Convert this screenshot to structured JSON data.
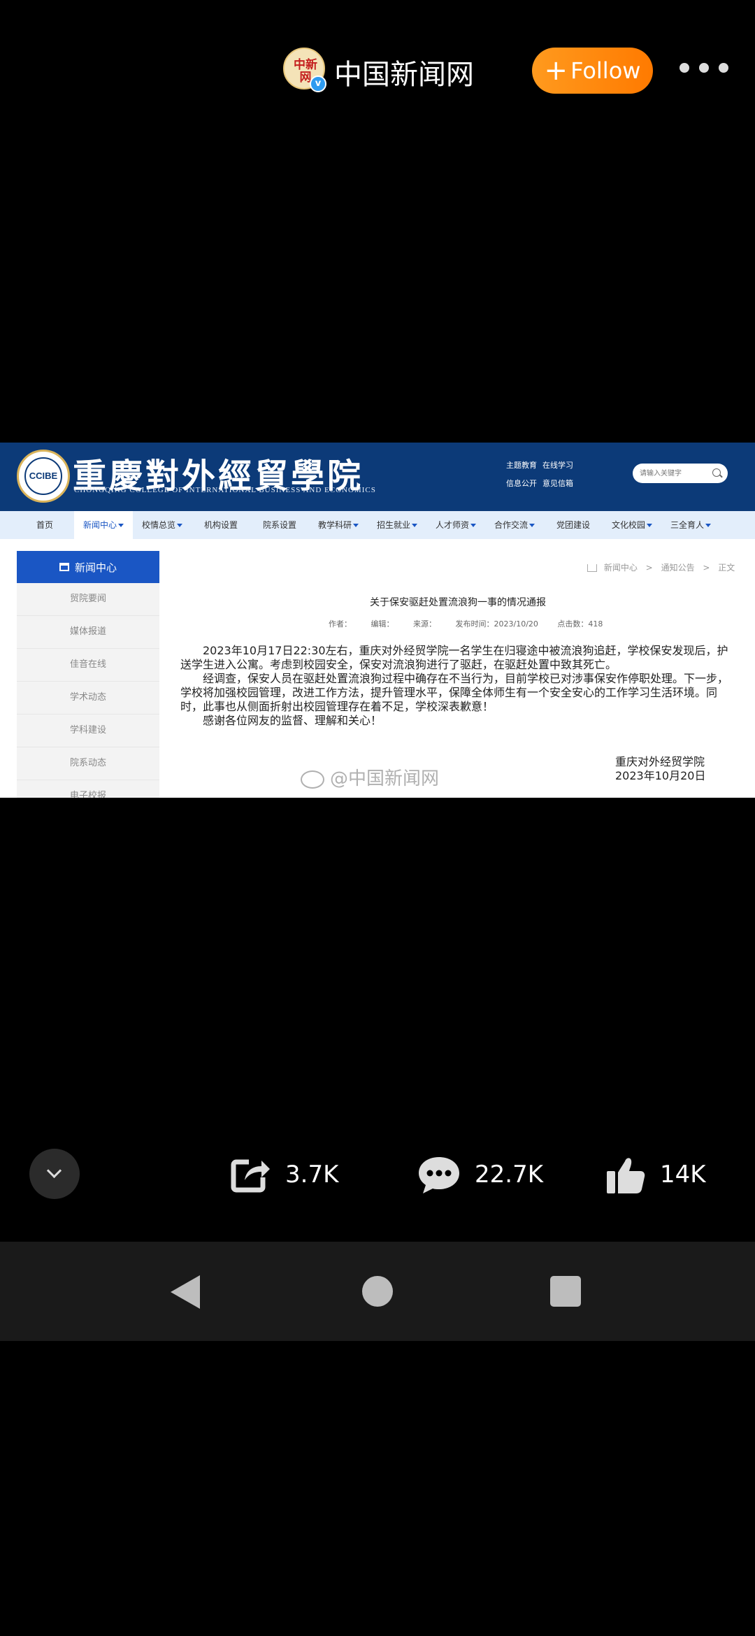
{
  "account": {
    "avatar_text": "中新网",
    "verified_mark": "v",
    "name": "中国新闻网",
    "follow_label": "Follow",
    "follow_plus": "+"
  },
  "webpage": {
    "school_name_cn": "重慶對外經貿學院",
    "school_name_en": "CHONGQING COLLEGE OF INTERNATIONAL BUSINESS AND ECONOMICS",
    "logo_text": "CCIBE",
    "quicklinks": [
      "主题教育",
      "在线学习",
      "信息公开",
      "意见信箱"
    ],
    "search_placeholder": "请输入关键字",
    "nav": [
      {
        "label": "首页",
        "caret": false,
        "active": false
      },
      {
        "label": "新闻中心",
        "caret": true,
        "active": true
      },
      {
        "label": "校情总览",
        "caret": true,
        "active": false
      },
      {
        "label": "机构设置",
        "caret": false,
        "active": false
      },
      {
        "label": "院系设置",
        "caret": false,
        "active": false
      },
      {
        "label": "教学科研",
        "caret": true,
        "active": false
      },
      {
        "label": "招生就业",
        "caret": true,
        "active": false
      },
      {
        "label": "人才师资",
        "caret": true,
        "active": false
      },
      {
        "label": "合作交流",
        "caret": true,
        "active": false
      },
      {
        "label": "党团建设",
        "caret": false,
        "active": false
      },
      {
        "label": "文化校园",
        "caret": true,
        "active": false
      },
      {
        "label": "三全育人",
        "caret": true,
        "active": false
      }
    ],
    "sidebar_title": "新闻中心",
    "sidebar_items": [
      "贸院要闻",
      "媒体报道",
      "佳音在线",
      "学术动态",
      "学科建设",
      "院系动态",
      "电子校报"
    ],
    "breadcrumb": [
      "新闻中心",
      "通知公告",
      "正文"
    ],
    "breadcrumb_sep": ">",
    "article_title": "关于保安驱赶处置流浪狗一事的情况通报",
    "meta": {
      "author": "作者：",
      "editor": "编辑：",
      "source": "来源：",
      "published": "发布时间：2023/10/20",
      "clicks": "点击数：418"
    },
    "paragraphs": [
      "2023年10月17日22:30左右，重庆对外经贸学院一名学生在归寝途中被流浪狗追赶，学校保安发现后，护送学生进入公寓。考虑到校园安全，保安对流浪狗进行了驱赶，在驱赶处置中致其死亡。",
      "经调查，保安人员在驱赶处置流浪狗过程中确存在不当行为，目前学校已对涉事保安作停职处理。下一步，学校将加强校园管理，改进工作方法，提升管理水平，保障全体师生有一个安全安心的工作学习生活环境。同时，此事也从侧面折射出校园管理存在着不足，学校深表歉意！",
      "感谢各位网友的监督、理解和关心！"
    ],
    "signature_org": "重庆对外经贸学院",
    "signature_date": "2023年10月20日",
    "watermark": "@中国新闻网"
  },
  "actions": {
    "share_count": "3.7K",
    "comment_count": "22.7K",
    "like_count": "14K"
  },
  "colors": {
    "follow": "#ff8a0a",
    "site_header": "#0c3a78",
    "site_accent": "#1a56c4"
  }
}
